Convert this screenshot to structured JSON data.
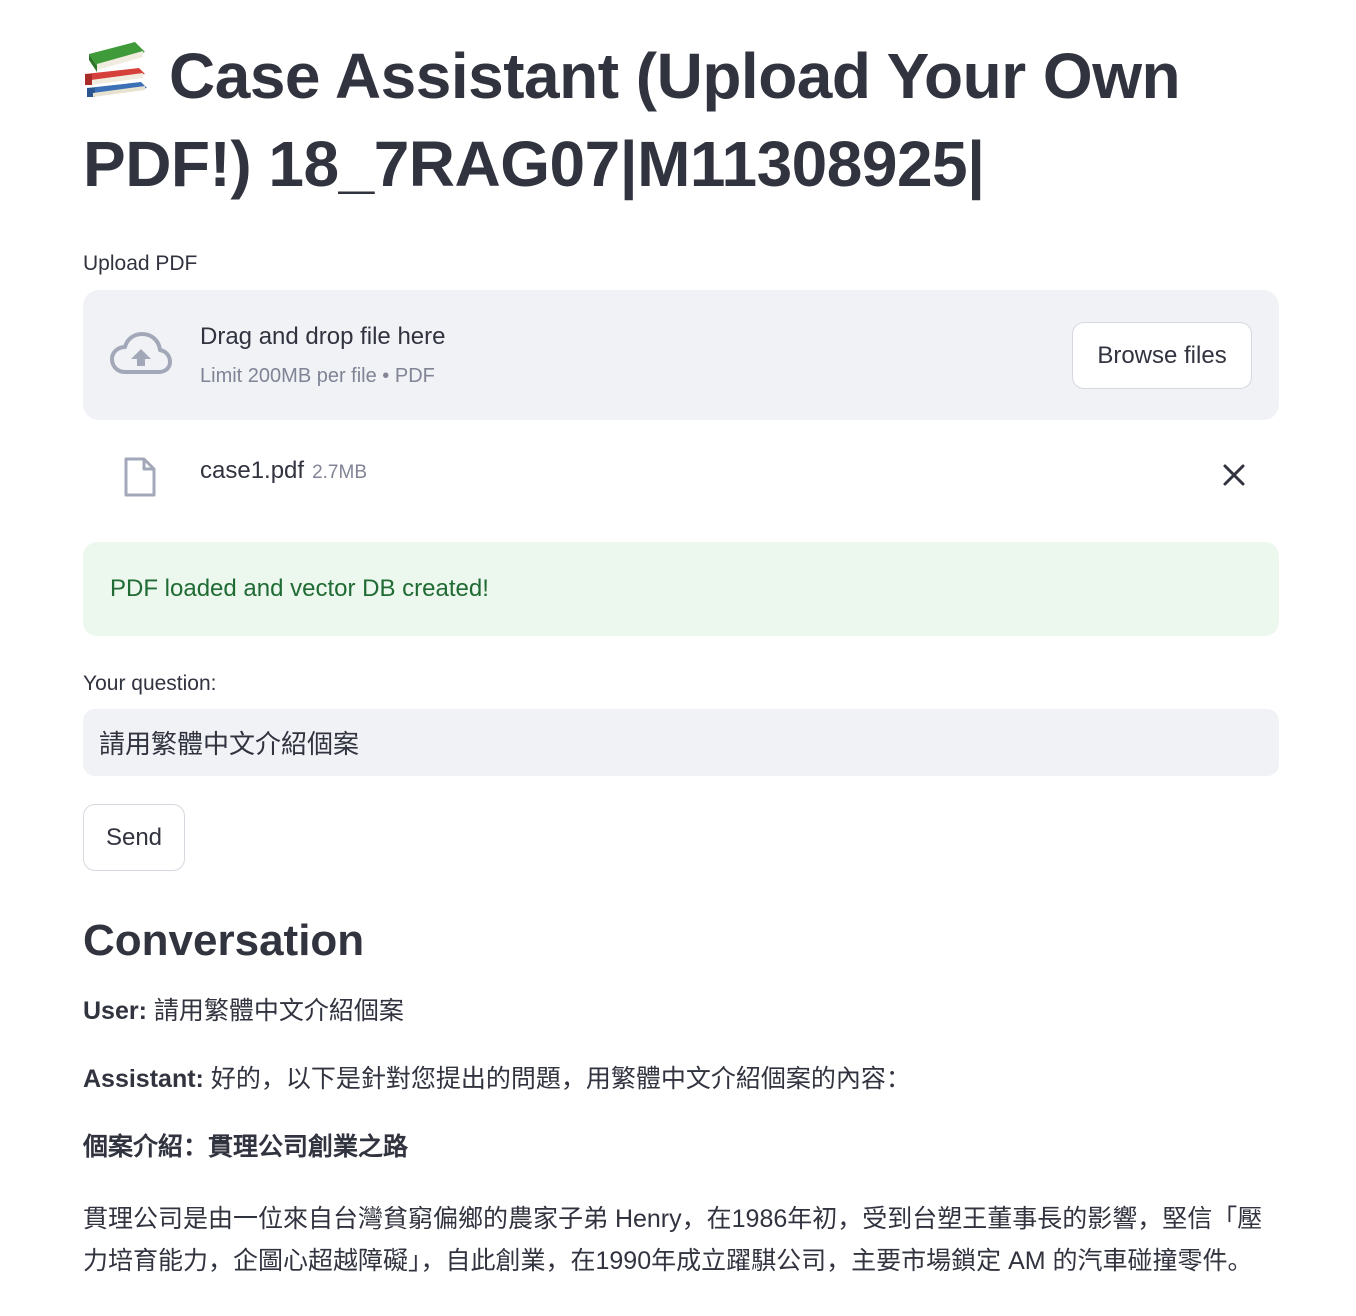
{
  "header": {
    "title_emoji": "books-emoji",
    "title": "Case Assistant (Upload Your Own PDF!) 18_7RAG07|M11308925|"
  },
  "uploader": {
    "label": "Upload PDF",
    "drop_text": "Drag and drop file here",
    "limit_text": "Limit 200MB per file • PDF",
    "browse_label": "Browse files",
    "icon": "cloud-upload-icon"
  },
  "uploaded_file": {
    "name": "case1.pdf",
    "size": "2.7MB",
    "icon": "file-icon",
    "remove_icon": "close-icon"
  },
  "alert": {
    "text": "PDF loaded and vector DB created!",
    "color": "#1f6b33",
    "background": "#ecf7ee"
  },
  "question": {
    "label": "Your question:",
    "value": "請用繁體中文介紹個案"
  },
  "send": {
    "label": "Send"
  },
  "conversation": {
    "heading": "Conversation",
    "user_prefix": "User:",
    "user_text": " 請用繁體中文介紹個案",
    "assistant_prefix": "Assistant:",
    "assistant_text": " 好的，以下是針對您提出的問題，用繁體中文介紹個案的內容：",
    "case_heading": "個案介紹：貫理公司創業之路",
    "paragraph": "貫理公司是由一位來自台灣貧窮偏鄉的農家子弟 Henry，在1986年初，受到台塑王董事長的影響，堅信「壓力培育能力，企圖心超越障礙」，自此創業，在1990年成立躍騏公司，主要市場鎖定 AM 的汽車碰撞零件。"
  }
}
